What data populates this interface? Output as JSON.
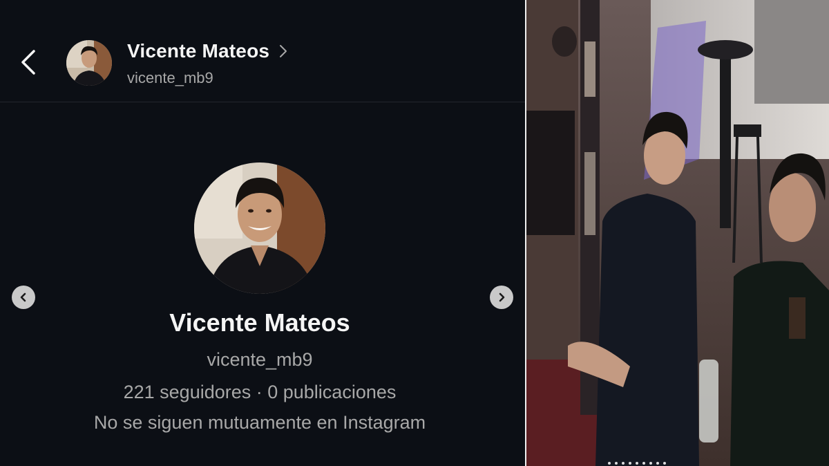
{
  "header": {
    "name": "Vicente Mateos",
    "username": "vicente_mb9",
    "back_icon": "chevron-left-icon",
    "name_chevron_icon": "chevron-right-icon"
  },
  "profile": {
    "name": "Vicente Mateos",
    "username": "vicente_mb9",
    "stats": "221 seguidores · 0 publicaciones",
    "mutual": "No se siguen mutuamente en Instagram"
  },
  "carousel": {
    "prev_icon": "chevron-left-icon",
    "next_icon": "chevron-right-icon"
  },
  "photo": {
    "description_icon": "bar-security-photo"
  },
  "colors": {
    "panel_bg": "#0c0f15",
    "primary_text": "#f5f5f5",
    "secondary_text": "#a8a8a8",
    "nav_button": "#c9c9c9"
  }
}
